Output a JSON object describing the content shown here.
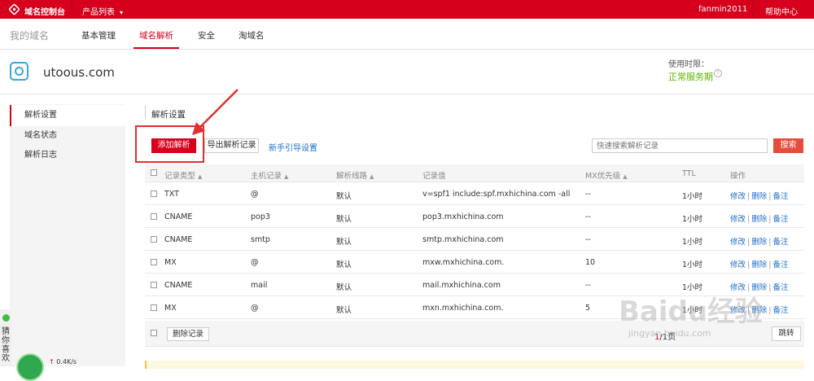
{
  "topbar": {
    "console_label": "域名控制台",
    "products_label": "产品列表",
    "user": "fanmin2011",
    "help": "帮助中心",
    "logo_icon": "aliyun-logo-icon",
    "bg_color": "#d6001c"
  },
  "nav": {
    "my_domain": "我的域名",
    "tabs": [
      {
        "label": "基本管理",
        "active": false
      },
      {
        "label": "域名解析",
        "active": true
      },
      {
        "label": "安全",
        "active": false
      },
      {
        "label": "淘域名",
        "active": false
      }
    ]
  },
  "domain": {
    "name": "utoous.com",
    "valid_label": "使用时限：",
    "valid_status": "正常服务期",
    "status_color": "#5cb400"
  },
  "sidebar": {
    "items": [
      {
        "label": "解析设置",
        "active": true
      },
      {
        "label": "域名状态",
        "active": false
      },
      {
        "label": "解析日志",
        "active": false
      }
    ]
  },
  "left_widget": {
    "text": "猜你喜欢",
    "speed": "0.4K/s"
  },
  "main": {
    "section_title": "解析设置",
    "add_button": "添加解析",
    "export_button": "导出解析记录",
    "guide_link": "新手引导设置",
    "search_placeholder": "快速搜索解析记录",
    "search_button": "搜索"
  },
  "table": {
    "headers": {
      "type": "记录类型",
      "host": "主机记录",
      "line": "解析线路",
      "value": "记录值",
      "mx": "MX优先级",
      "ttl": "TTL",
      "ops": "操作"
    },
    "op_labels": {
      "edit": "修改",
      "delete": "删除",
      "note": "备注"
    },
    "rows": [
      {
        "type": "TXT",
        "host": "@",
        "line": "默认",
        "value": "v=spf1 include:spf.mxhichina.com -all",
        "mx": "--",
        "ttl": "1小时"
      },
      {
        "type": "CNAME",
        "host": "pop3",
        "line": "默认",
        "value": "pop3.mxhichina.com",
        "mx": "--",
        "ttl": "1小时"
      },
      {
        "type": "CNAME",
        "host": "smtp",
        "line": "默认",
        "value": "smtp.mxhichina.com",
        "mx": "--",
        "ttl": "1小时"
      },
      {
        "type": "MX",
        "host": "@",
        "line": "默认",
        "value": "mxw.mxhichina.com.",
        "mx": "10",
        "ttl": "1小时"
      },
      {
        "type": "CNAME",
        "host": "mail",
        "line": "默认",
        "value": "mail.mxhichina.com",
        "mx": "--",
        "ttl": "1小时"
      },
      {
        "type": "MX",
        "host": "@",
        "line": "默认",
        "value": "mxn.mxhichina.com.",
        "mx": "5",
        "ttl": "1小时"
      }
    ],
    "delete_button": "删除记录",
    "page_current": "1",
    "page_total": "/1页",
    "jump_button": "跳转"
  },
  "watermark": {
    "text": "Baidu经验",
    "url": "jingyan.baidu.com"
  }
}
